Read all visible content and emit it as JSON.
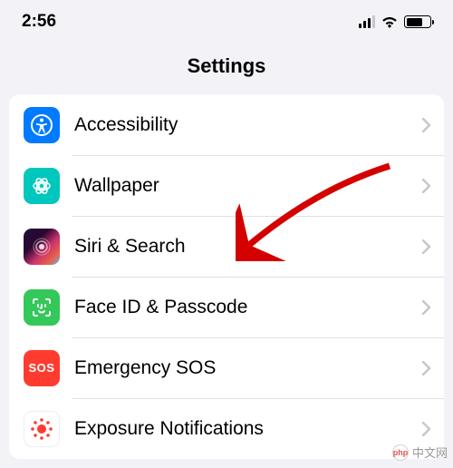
{
  "status": {
    "time": "2:56"
  },
  "header": {
    "title": "Settings"
  },
  "rows": {
    "accessibility": {
      "label": "Accessibility"
    },
    "wallpaper": {
      "label": "Wallpaper"
    },
    "siri": {
      "label": "Siri & Search"
    },
    "faceid": {
      "label": "Face ID & Passcode"
    },
    "sos": {
      "label": "Emergency SOS",
      "icon_text": "SOS"
    },
    "exposure": {
      "label": "Exposure Notifications"
    }
  },
  "watermark": {
    "logo_text": "php",
    "text": "中文网"
  }
}
